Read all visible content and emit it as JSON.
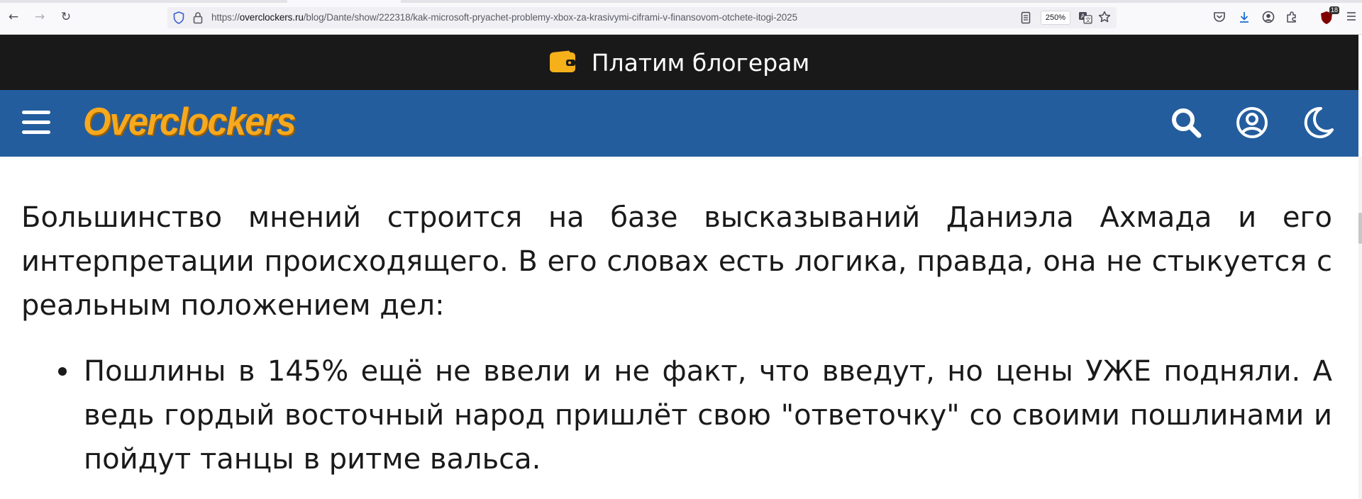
{
  "browser": {
    "url_prefix": "https://",
    "url_domain": "overclockers.ru",
    "url_path": "/blog/Dante/show/222318/kak-microsoft-pryachet-problemy-xbox-za-krasivymi-ciframi-v-finansovom-otchete-itogi-2025",
    "zoom": "250%",
    "extension_badge": "18",
    "nav": {
      "back_icon": "←",
      "forward_icon": "→",
      "reload_icon": "↻"
    }
  },
  "promo": {
    "text": "Платим блогерам",
    "icon": "wallet-icon",
    "accent": "#f6b01a"
  },
  "header": {
    "logo": "Overclockers",
    "bg": "#245d9e",
    "logo_color": "#f7a91e"
  },
  "article": {
    "paragraph": "Большинство мнений строится на базе высказываний Даниэла Ахмада и его интерпретации происходящего. В его словах есть логика, правда, она не стыкуется с реальным положением дел:",
    "bullets": [
      "Пошлины в 145% ещё не ввели и не факт, что введут, но цены УЖЕ подняли. А ведь гордый восточный народ пришлёт свою \"ответочку\" со своими пошлинами и пойдут танцы в ритме вальса."
    ]
  }
}
